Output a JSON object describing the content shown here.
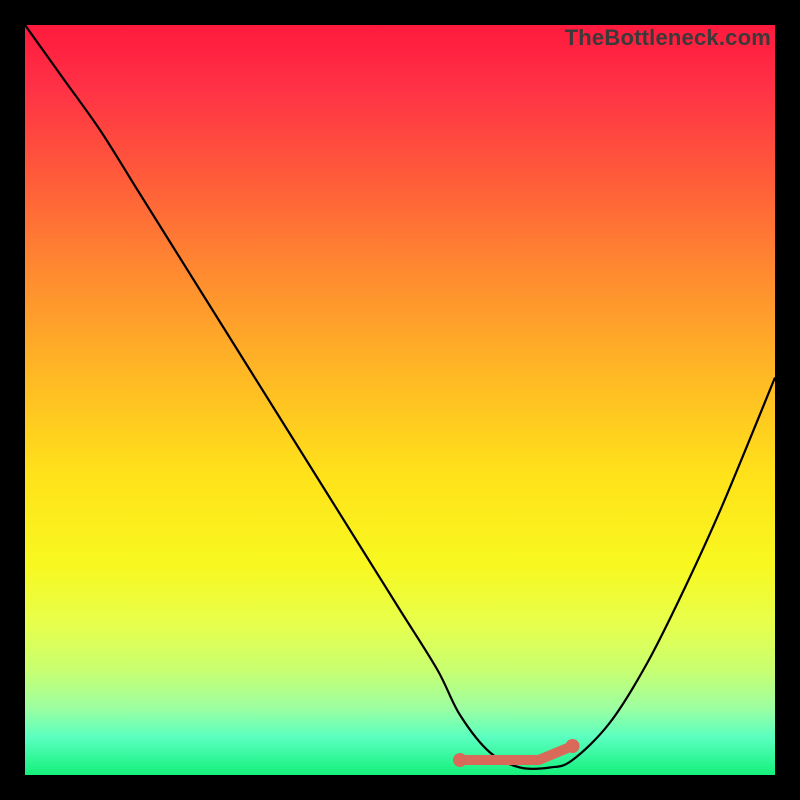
{
  "brand": "TheBottleneck.com",
  "chart_data": {
    "type": "line",
    "title": "",
    "xlabel": "",
    "ylabel": "",
    "xlim": [
      0,
      100
    ],
    "ylim": [
      0,
      100
    ],
    "series": [
      {
        "name": "bottleneck-curve",
        "x": [
          0,
          5,
          10,
          15,
          20,
          25,
          30,
          35,
          40,
          45,
          50,
          55,
          58,
          62,
          66,
          70,
          73,
          78,
          83,
          88,
          93,
          100
        ],
        "values": [
          100,
          93,
          86,
          78,
          70,
          62,
          54,
          46,
          38,
          30,
          22,
          14,
          8,
          3,
          1,
          1,
          2,
          7,
          15,
          25,
          36,
          53
        ]
      }
    ],
    "optimal_range": {
      "start": 58,
      "end": 73,
      "value": 2
    },
    "background": {
      "type": "vertical-gradient",
      "stops": [
        {
          "pos": 0.0,
          "color": "#ff1a3d"
        },
        {
          "pos": 0.2,
          "color": "#ff5a3a"
        },
        {
          "pos": 0.46,
          "color": "#ffb625"
        },
        {
          "pos": 0.72,
          "color": "#f8f820"
        },
        {
          "pos": 1.0,
          "color": "#14f07a"
        }
      ]
    }
  }
}
